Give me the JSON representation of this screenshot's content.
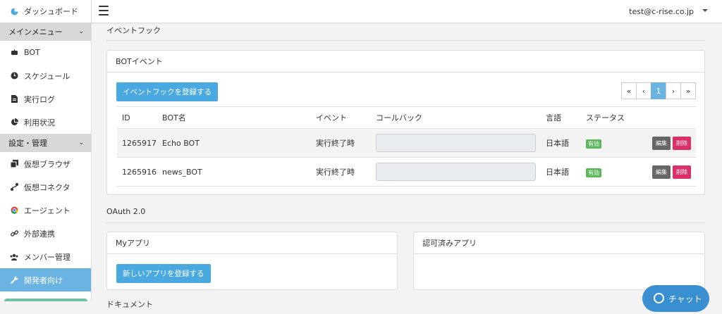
{
  "sidebar": {
    "dashboard": "ダッシュボード",
    "menu_header": "メインメニュー",
    "menu_items": [
      "BOT",
      "スケジュール",
      "実行ログ",
      "利用状況"
    ],
    "settings_header": "設定・管理",
    "settings_items": [
      "仮想ブラウザ",
      "仮想コネクタ",
      "エージェント",
      "外部連携",
      "メンバー管理",
      "開発者向け"
    ]
  },
  "topbar": {
    "user_email": "test@c-rise.co.jp"
  },
  "event_hook": {
    "section_title": "イベントフック",
    "panel_title": "BOTイベント",
    "register_button": "イベントフックを登録する",
    "pagination": {
      "first": "«",
      "prev": "‹",
      "current": "1",
      "next": "›",
      "last": "»"
    },
    "columns": [
      "ID",
      "BOT名",
      "イベント",
      "コールバック",
      "言語",
      "ステータス"
    ],
    "rows": [
      {
        "id": "1265917",
        "bot_name": "Echo BOT",
        "event": "実行終了時",
        "callback": "",
        "language": "日本語",
        "status": "有効",
        "edit": "編集",
        "delete": "削除"
      },
      {
        "id": "1265916",
        "bot_name": "news_BOT",
        "event": "実行終了時",
        "callback": "",
        "language": "日本語",
        "status": "有効",
        "edit": "編集",
        "delete": "削除"
      }
    ]
  },
  "oauth": {
    "section_title": "OAuth 2.0",
    "my_apps_title": "Myアプリ",
    "register_app_button": "新しいアプリを登録する",
    "authorized_apps_title": "認可済みアプリ"
  },
  "docs": {
    "section_title": "ドキュメント"
  },
  "chat": {
    "label": "チャット"
  },
  "colors": {
    "accent_blue": "#4aa9e0",
    "active_sidebar": "#6bb3e3",
    "badge_green": "#5cb85c",
    "delete_red": "#d9306a"
  }
}
